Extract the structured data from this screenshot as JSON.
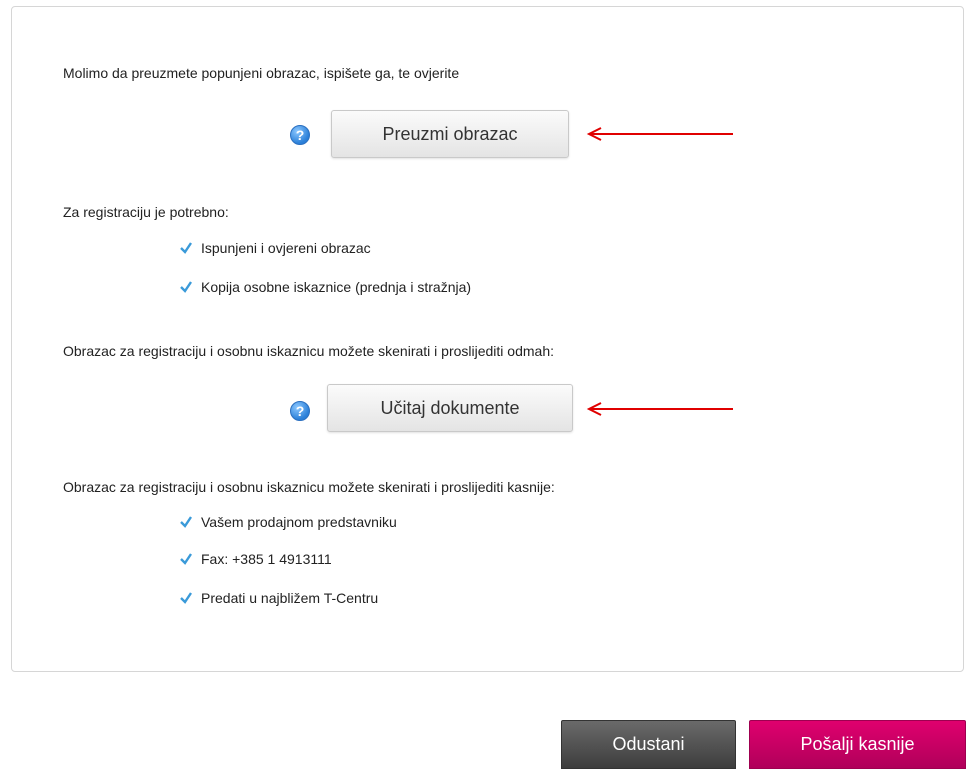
{
  "intro_text": "Molimo da preuzmete popunjeni obrazac, ispišete ga, te ovjerite",
  "download_button": {
    "label": "Preuzmi obrazac",
    "help_icon": "?"
  },
  "requirements": {
    "heading": "Za registraciju je potrebno:",
    "items": [
      "Ispunjeni i ovjereni obrazac",
      "Kopija osobne iskaznice (prednja i stražnja)"
    ]
  },
  "scan_now": {
    "text": "Obrazac za registraciju i osobnu iskaznicu možete skenirati i proslijediti odmah:",
    "button_label": "Učitaj dokumente",
    "help_icon": "?"
  },
  "scan_later": {
    "text": "Obrazac za registraciju i osobnu iskaznicu možete skenirati i proslijediti kasnije:",
    "items": [
      "Vašem prodajnom predstavniku",
      "Fax: +385 1 4913111",
      "Predati u najbližem T-Centru"
    ]
  },
  "footer": {
    "cancel_label": "Odustani",
    "send_later_label": "Pošalji kasnije"
  },
  "colors": {
    "accent": "#e20074",
    "check": "#3a9ad9",
    "arrow": "#e00000"
  }
}
